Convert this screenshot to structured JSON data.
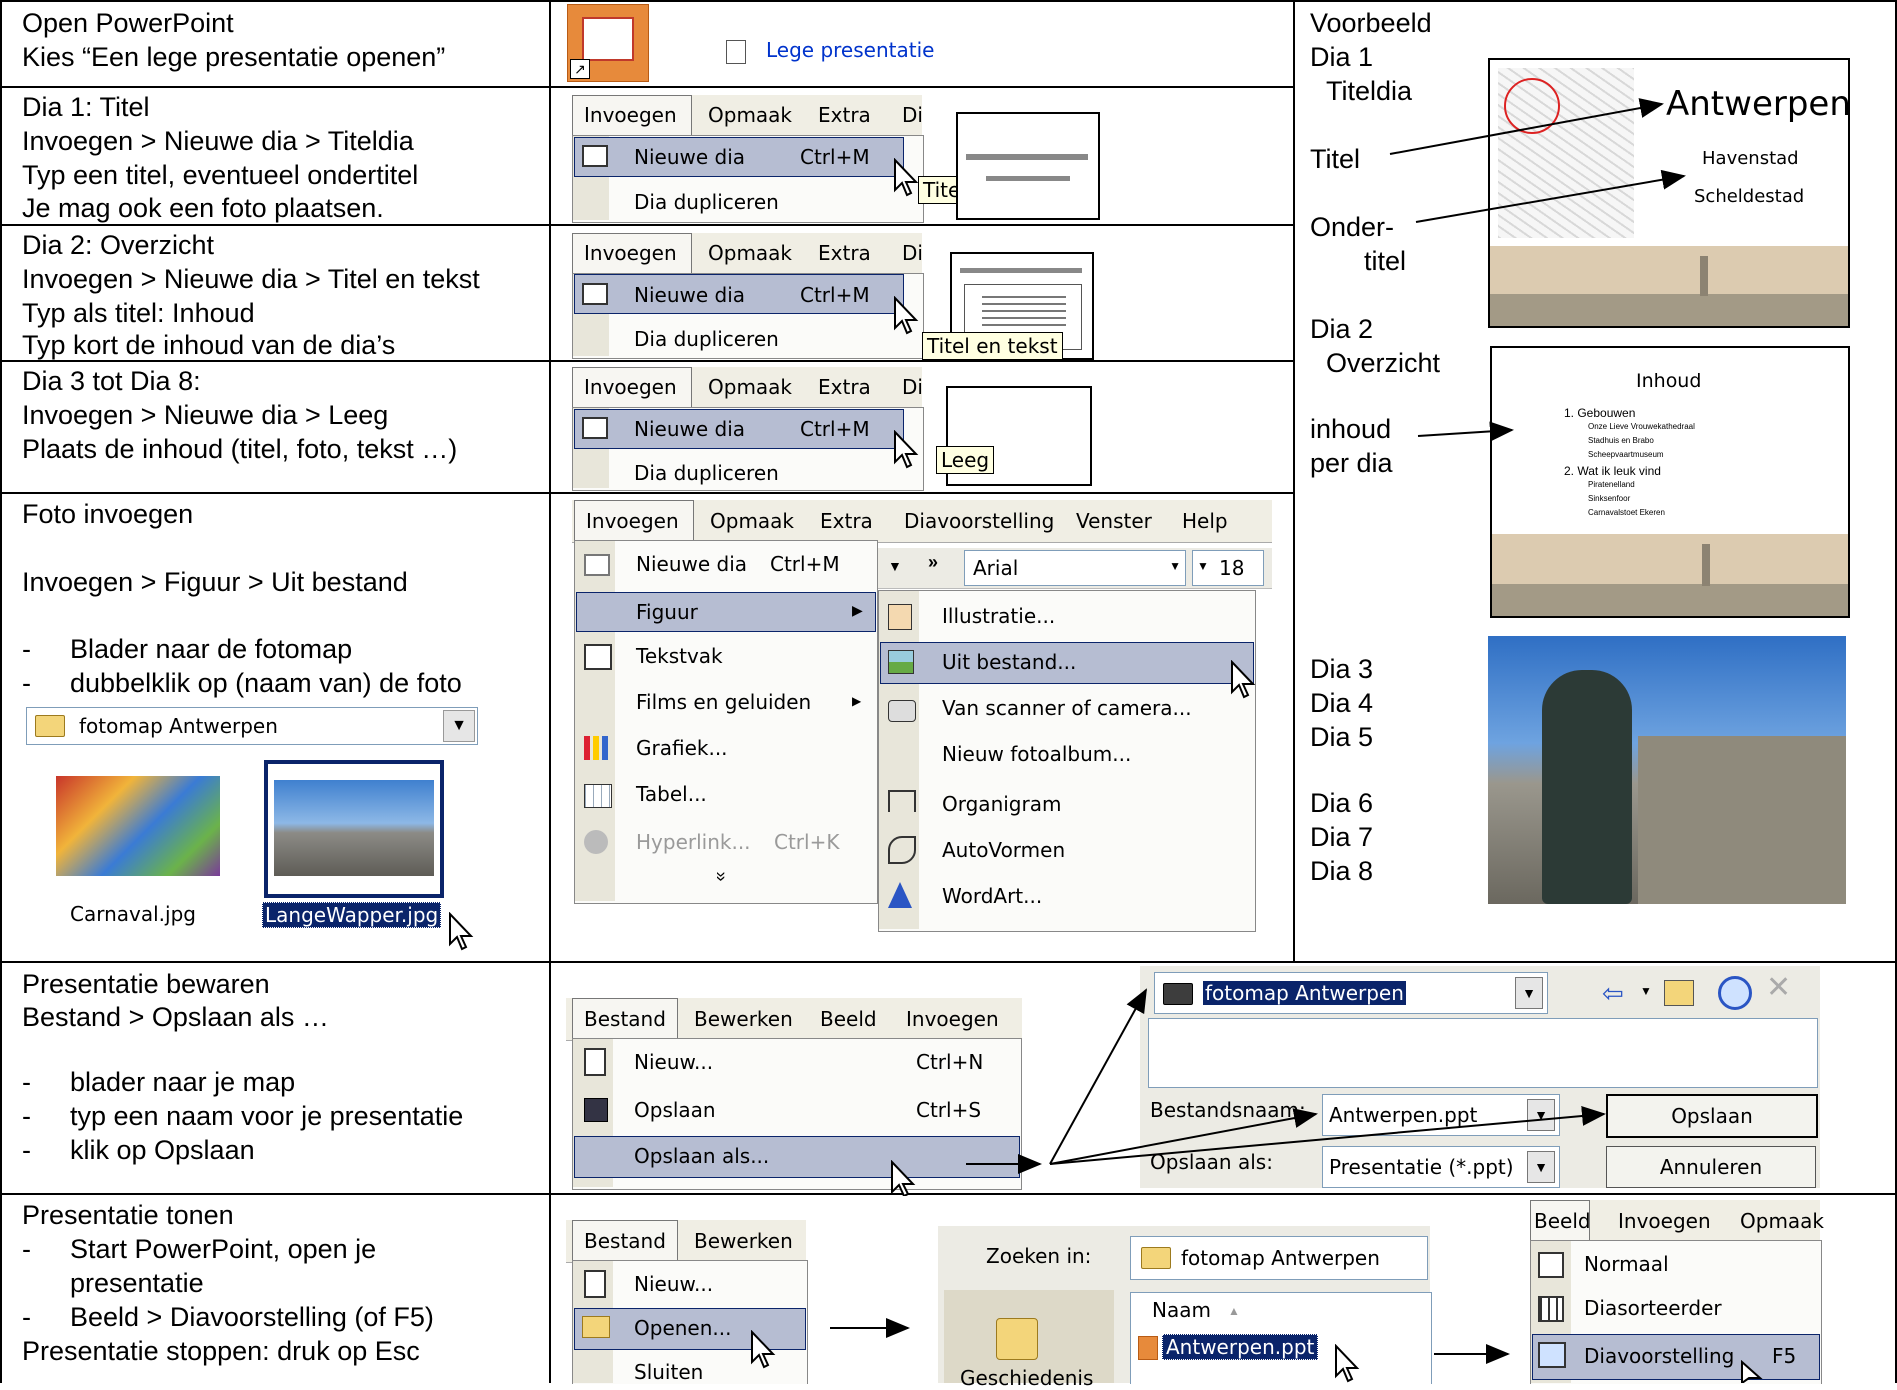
{
  "instructions": {
    "r1": [
      "Open PowerPoint",
      "Kies “Een lege presentatie openen”"
    ],
    "r2": [
      "Dia 1: Titel",
      "Invoegen > Nieuwe dia > Titeldia",
      "Typ een titel, eventueel ondertitel",
      "Je mag ook een foto plaatsen."
    ],
    "r3": [
      "Dia 2: Overzicht",
      "Invoegen > Nieuwe dia > Titel en tekst",
      "Typ als titel: Inhoud",
      "Typ kort de inhoud van de dia’s"
    ],
    "r4": [
      "Dia 3 tot Dia 8:",
      "Invoegen > Nieuwe dia > Leeg",
      "Plaats de inhoud (titel, foto, tekst …)"
    ],
    "r5": [
      "Foto invoegen",
      "Invoegen > Figuur > Uit bestand",
      "Blader naar de fotomap",
      "dubbelklik op (naam van) de foto"
    ],
    "r6": [
      "Presentatie bewaren",
      "Bestand > Opslaan als …",
      "blader naar je map",
      "typ een naam voor je presentatie",
      "klik op Opslaan"
    ],
    "r7": [
      "Presentatie tonen",
      "Start PowerPoint, open je",
      "presentatie",
      "Beeld > Diavoorstelling (of F5)",
      "Presentatie stoppen: druk op Esc"
    ],
    "dash": "-"
  },
  "ui": {
    "lege_presentatie": "Lege presentatie",
    "menus": {
      "invoegen": "Invoegen",
      "opmaak": "Opmaak",
      "extra": "Extra",
      "di": "Di",
      "diavoorstelling": "Diavoorstelling",
      "venster": "Venster",
      "help": "Help",
      "bestand": "Bestand",
      "bewerken": "Bewerken",
      "beeld": "Beeld"
    },
    "nieuwe_dia": "Nieuwe dia",
    "shortcut_ctrl_m": "Ctrl+M",
    "dia_dupliceren": "Dia dupliceren",
    "tooltips": {
      "titeldia": "Titeldia",
      "titel_tekst": "Titel en tekst",
      "leeg": "Leeg"
    },
    "invoegen_menu": [
      "Figuur",
      "Tekstvak",
      "Films en geluiden",
      "Grafiek...",
      "Tabel...",
      "Hyperlink...",
      "Ctrl+K",
      "»"
    ],
    "font_name": "Arial",
    "font_size": "18",
    "figuur_sub": [
      "Illustratie...",
      "Uit bestand...",
      "Van scanner of camera...",
      "Nieuw fotoalbum...",
      "Organigram",
      "AutoVormen",
      "WordArt..."
    ],
    "folder_name": "fotomap Antwerpen",
    "files": [
      "Carnaval.jpg",
      "LangeWapper.jpg"
    ],
    "bestand_menu": [
      "Nieuw...",
      "Ctrl+N",
      "Opslaan",
      "Ctrl+S",
      "Opslaan als..."
    ],
    "save_dialog": {
      "folder": "fotomap Antwerpen",
      "bestandsnaam_label": "Bestandsnaam:",
      "bestandsnaam": "Antwerpen.ppt",
      "opslaan_als_label": "Opslaan als:",
      "type": "Presentatie (*.ppt)",
      "opslaan_btn": "Opslaan",
      "annuleren_btn": "Annuleren"
    },
    "open_menu": [
      "Nieuw...",
      "Openen...",
      "Sluiten"
    ],
    "open_dialog": {
      "zoeken_in": "Zoeken in:",
      "folder": "fotomap Antwerpen",
      "naam_col": "Naam",
      "file": "Antwerpen.ppt",
      "geschiedenis": "Geschiedenis"
    },
    "beeld_menu": [
      "Normaal",
      "Diasorteerder",
      "Diavoorstelling",
      "F5"
    ]
  },
  "example": {
    "header": [
      "Voorbeeld",
      "Dia 1",
      "Titeldia"
    ],
    "titel": "Titel",
    "onder": [
      "Onder-",
      "titel"
    ],
    "dia2": [
      "Dia 2",
      "Overzicht"
    ],
    "inhoud_per_dia": [
      "inhoud",
      "per dia"
    ],
    "dias": [
      "Dia 3",
      "Dia 4",
      "Dia 5",
      "Dia 6",
      "Dia 7",
      "Dia 8"
    ],
    "slide1": {
      "title": "Antwerpen",
      "sub1": "Havenstad",
      "sub2": "Scheldestad"
    },
    "slide2": {
      "title": "Inhoud",
      "items": [
        "1.  Gebouwen",
        "Onze Lieve Vrouwekathedraal",
        "Stadhuis en Brabo",
        "Scheepvaartmuseum",
        "2.  Wat ik leuk vind",
        "Piratenelland",
        "Sinksenfoor",
        "Carnavalstoet Ekeren"
      ]
    }
  }
}
